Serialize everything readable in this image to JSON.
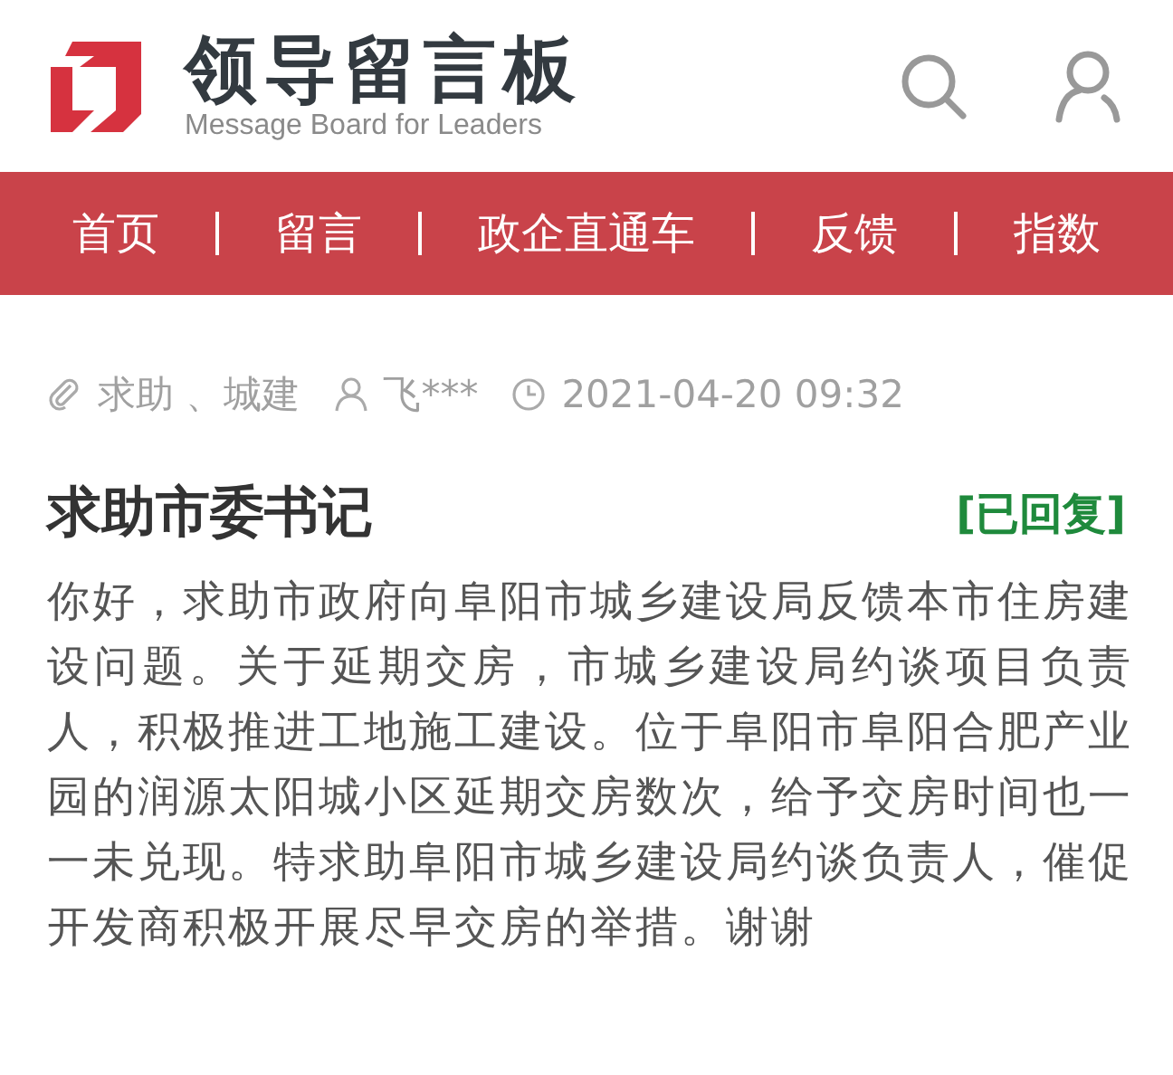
{
  "header": {
    "title": "领导留言板",
    "subtitle": "Message Board for Leaders"
  },
  "nav": [
    {
      "label": "首页"
    },
    {
      "label": "留言"
    },
    {
      "label": "政企直通车"
    },
    {
      "label": "反馈"
    },
    {
      "label": "指数"
    }
  ],
  "meta": {
    "tags": "求助 、城建",
    "author": "飞***",
    "time": "2021-04-20 09:32"
  },
  "post": {
    "title": "求助市委书记",
    "status": "[已回复]",
    "body": "你好，求助市政府向阜阳市城乡建设局反馈本市住房建设问题。关于延期交房，市城乡建设局约谈项目负责人，积极推进工地施工建设。位于阜阳市阜阳合肥产业园的润源太阳城小区延期交房数次，给予交房时间也一一未兑现。特求助阜阳市城乡建设局约谈负责人，催促开发商积极开展尽早交房的举措。谢谢"
  }
}
